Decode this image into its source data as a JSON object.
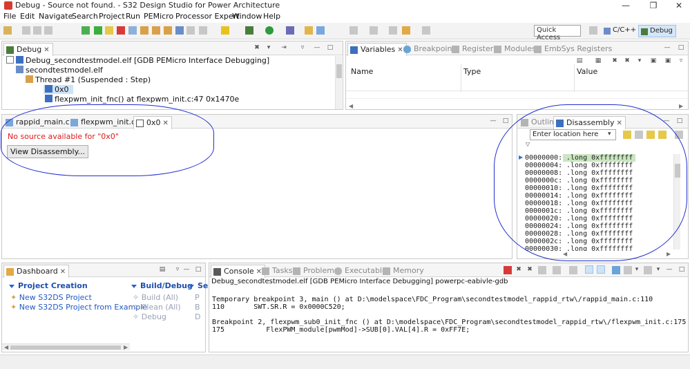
{
  "window": {
    "title": "Debug - Source not found. - S32 Design Studio for Power Architecture",
    "controls": {
      "minimize": "—",
      "maximize": "❐",
      "close": "✕"
    }
  },
  "menu": [
    "File",
    "Edit",
    "Navigate",
    "Search",
    "Project",
    "Run",
    "PEMicro",
    "Processor Expert",
    "Window",
    "Help"
  ],
  "toolbar": {
    "quick_access": "Quick Access",
    "perspectives": [
      {
        "label": "C/C++",
        "active": false
      },
      {
        "label": "Debug",
        "active": true
      }
    ]
  },
  "debug_view": {
    "tab": "Debug",
    "tree": [
      {
        "label": "Debug_secondtestmodel.elf [GDB PEMicro Interface Debugging]"
      },
      {
        "label": "secondtestmodel.elf"
      },
      {
        "label": "Thread #1 (Suspended : Step)"
      },
      {
        "label": "0x0",
        "selected": true
      },
      {
        "label": "flexpwm_init_fnc() at flexpwm_init.c:47 0x1470e"
      }
    ]
  },
  "variables_view": {
    "tabs": [
      "Variables",
      "Breakpoints",
      "Registers",
      "Modules",
      "EmbSys Registers"
    ],
    "columns": [
      "Name",
      "Type",
      "Value"
    ]
  },
  "editor": {
    "tabs": [
      "rappid_main.c",
      "flexpwm_init.c",
      "0x0"
    ],
    "message": "No source available for \"0x0\"",
    "button": "View Disassembly..."
  },
  "disassembly": {
    "tabs": [
      "Outline",
      "Disassembly"
    ],
    "location_placeholder": "Enter location here",
    "rows": [
      {
        "addr": "00000000:",
        "ins": ".long 0xffffffff"
      },
      {
        "addr": "00000004:",
        "ins": ".long 0xffffffff"
      },
      {
        "addr": "00000008:",
        "ins": ".long 0xffffffff"
      },
      {
        "addr": "0000000c:",
        "ins": ".long 0xffffffff"
      },
      {
        "addr": "00000010:",
        "ins": ".long 0xffffffff"
      },
      {
        "addr": "00000014:",
        "ins": ".long 0xffffffff"
      },
      {
        "addr": "00000018:",
        "ins": ".long 0xffffffff"
      },
      {
        "addr": "0000001c:",
        "ins": ".long 0xffffffff"
      },
      {
        "addr": "00000020:",
        "ins": ".long 0xffffffff"
      },
      {
        "addr": "00000024:",
        "ins": ".long 0xffffffff"
      },
      {
        "addr": "00000028:",
        "ins": ".long 0xffffffff"
      },
      {
        "addr": "0000002c:",
        "ins": ".long 0xffffffff"
      },
      {
        "addr": "00000030:",
        "ins": ".long 0xffffffff"
      }
    ]
  },
  "dashboard": {
    "tab": "Dashboard",
    "project_creation": {
      "header": "Project Creation",
      "links": [
        "New S32DS Project",
        "New S32DS Project from Example"
      ]
    },
    "build_debug": {
      "header": "Build/Debug",
      "links": [
        "Build  (All)",
        "Clean  (All)",
        "Debug"
      ]
    },
    "settings_header": "Se",
    "third_col_letters": [
      "P",
      "B",
      "D"
    ]
  },
  "console": {
    "tabs": [
      "Console",
      "Tasks",
      "Problems",
      "Executables",
      "Memory"
    ],
    "session": "Debug_secondtestmodel.elf [GDB PEMicro Interface Debugging] powerpc-eabivle-gdb",
    "lines": [
      "Temporary breakpoint 3, main () at D:\\modelspace\\FDC_Program\\secondtestmodel_rappid_rtw\\/rappid_main.c:110",
      "110       SWT.SR.R = 0x0000C520;",
      "",
      "Breakpoint 2, flexpwm_sub0_init_fnc () at D:\\modelspace\\FDC_Program\\secondtestmodel_rappid_rtw\\/flexpwm_init.c:175",
      "175          FlexPWM_module[pwmMod]->SUB[0].VAL[4].R = 0xFF7E;"
    ]
  },
  "colors": {
    "annotation": "#1f2ccf",
    "error_text": "#e01818",
    "link": "#2259c5",
    "selection": "#cde3f7"
  }
}
